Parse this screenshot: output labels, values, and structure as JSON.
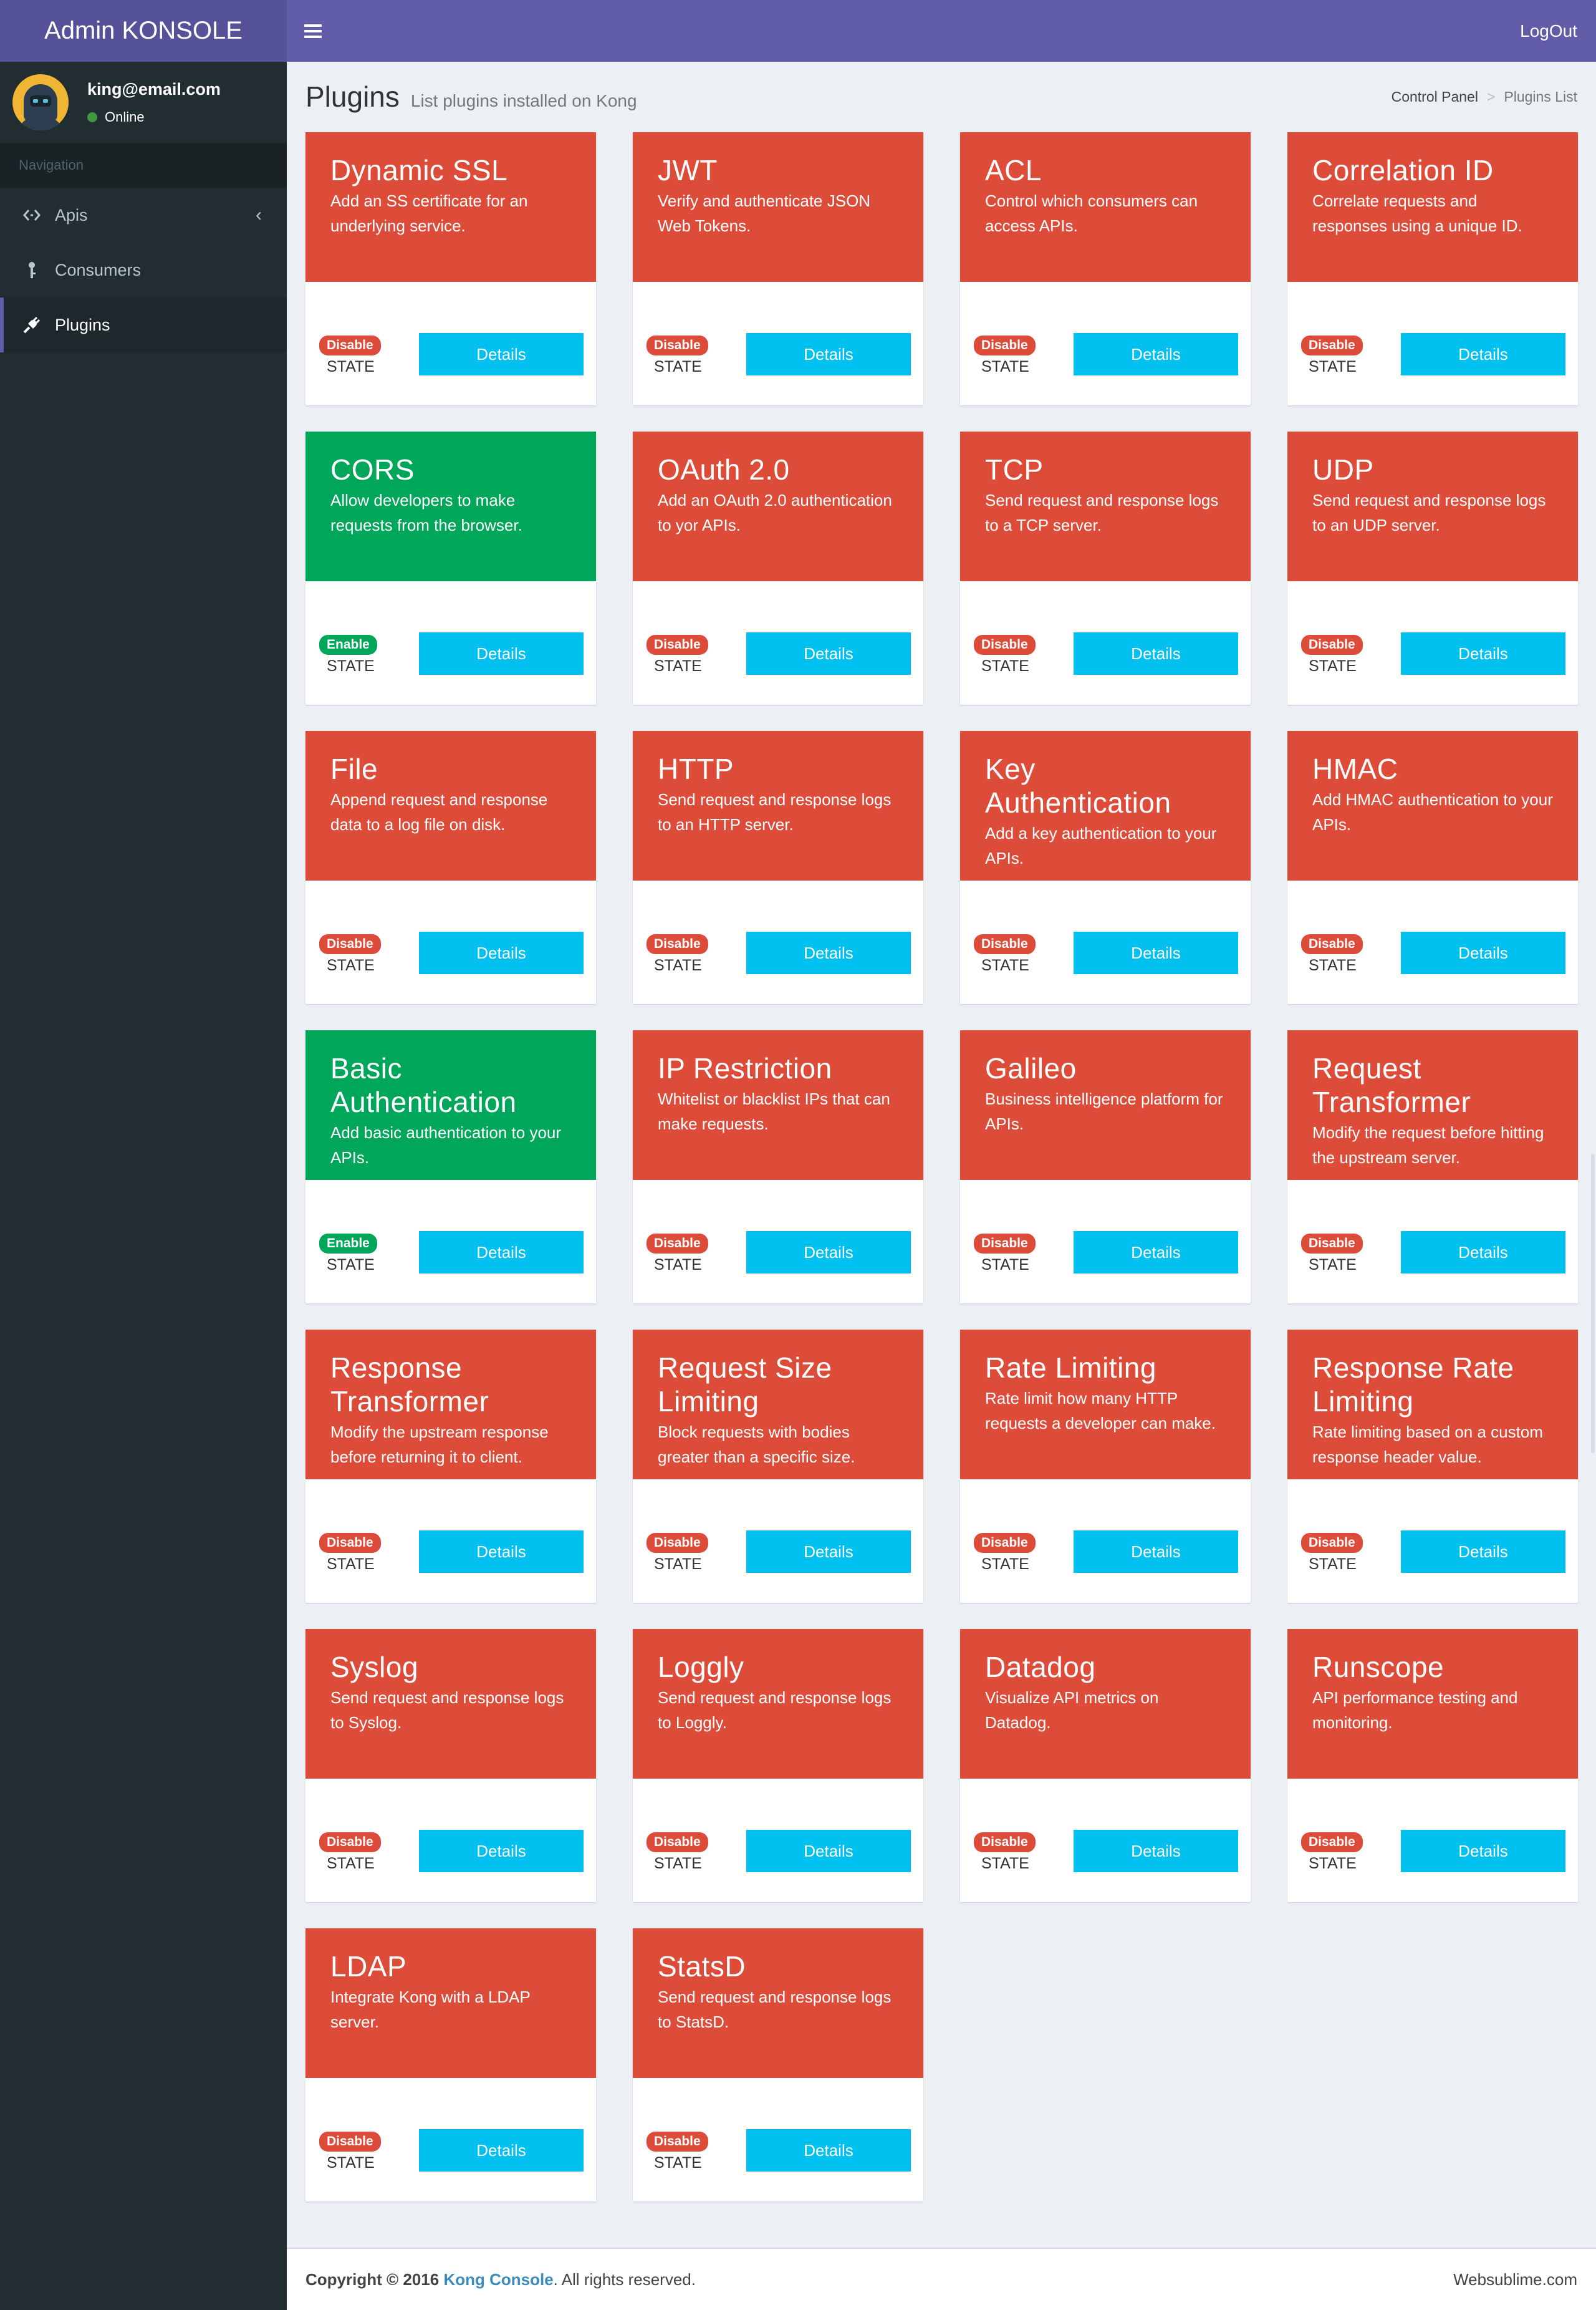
{
  "header": {
    "logo": "Admin KONSOLE",
    "logout": "LogOut"
  },
  "user": {
    "email": "king@email.com",
    "status": "Online"
  },
  "nav": {
    "header": "Navigation",
    "items": [
      {
        "label": "Apis",
        "icon": "code-icon"
      },
      {
        "label": "Consumers",
        "icon": "key-icon"
      },
      {
        "label": "Plugins",
        "icon": "plug-icon"
      }
    ]
  },
  "page": {
    "title": "Plugins",
    "subtitle": "List plugins installed on Kong"
  },
  "breadcrumb": {
    "home": "Control Panel",
    "current": "Plugins List"
  },
  "card_state_label": "STATE",
  "card_button_label": "Details",
  "plugins": [
    {
      "name": "Dynamic SSL",
      "description": "Add an SS certificate for an underlying service.",
      "state": "Disable",
      "color": "#dd4b39"
    },
    {
      "name": "JWT",
      "description": "Verify and authenticate JSON Web Tokens.",
      "state": "Disable",
      "color": "#dd4b39"
    },
    {
      "name": "ACL",
      "description": "Control which consumers can access APIs.",
      "state": "Disable",
      "color": "#dd4b39"
    },
    {
      "name": "Correlation ID",
      "description": "Correlate requests and responses using a unique ID.",
      "state": "Disable",
      "color": "#dd4b39"
    },
    {
      "name": "CORS",
      "description": "Allow developers to make requests from the browser.",
      "state": "Enable",
      "color": "#00a65a"
    },
    {
      "name": "OAuth 2.0",
      "description": "Add an OAuth 2.0 authentication to yor APIs.",
      "state": "Disable",
      "color": "#dd4b39"
    },
    {
      "name": "TCP",
      "description": "Send request and response logs to a TCP server.",
      "state": "Disable",
      "color": "#dd4b39"
    },
    {
      "name": "UDP",
      "description": "Send request and response logs to an UDP server.",
      "state": "Disable",
      "color": "#dd4b39"
    },
    {
      "name": "File",
      "description": "Append request and response data to a log file on disk.",
      "state": "Disable",
      "color": "#dd4b39"
    },
    {
      "name": "HTTP",
      "description": "Send request and response logs to an HTTP server.",
      "state": "Disable",
      "color": "#dd4b39"
    },
    {
      "name": "Key Authentication",
      "description": "Add a key authentication to your APIs.",
      "state": "Disable",
      "color": "#dd4b39"
    },
    {
      "name": "HMAC",
      "description": "Add HMAC authentication to your APIs.",
      "state": "Disable",
      "color": "#dd4b39"
    },
    {
      "name": "Basic Authentication",
      "description": "Add basic authentication to your APIs.",
      "state": "Enable",
      "color": "#00a65a"
    },
    {
      "name": "IP Restriction",
      "description": "Whitelist or blacklist IPs that can make requests.",
      "state": "Disable",
      "color": "#dd4b39"
    },
    {
      "name": "Galileo",
      "description": "Business intelligence platform for APIs.",
      "state": "Disable",
      "color": "#dd4b39"
    },
    {
      "name": "Request Transformer",
      "description": "Modify the request before hitting the upstream server.",
      "state": "Disable",
      "color": "#dd4b39"
    },
    {
      "name": "Response Transformer",
      "description": "Modify the upstream response before returning it to client.",
      "state": "Disable",
      "color": "#dd4b39"
    },
    {
      "name": "Request Size Limiting",
      "description": "Block requests with bodies greater than a specific size.",
      "state": "Disable",
      "color": "#dd4b39"
    },
    {
      "name": "Rate Limiting",
      "description": "Rate limit how many HTTP requests a developer can make.",
      "state": "Disable",
      "color": "#dd4b39"
    },
    {
      "name": "Response Rate Limiting",
      "description": "Rate limiting based on a custom response header value.",
      "state": "Disable",
      "color": "#dd4b39"
    },
    {
      "name": "Syslog",
      "description": "Send request and response logs to Syslog.",
      "state": "Disable",
      "color": "#dd4b39"
    },
    {
      "name": "Loggly",
      "description": "Send request and response logs to Loggly.",
      "state": "Disable",
      "color": "#dd4b39"
    },
    {
      "name": "Datadog",
      "description": "Visualize API metrics on Datadog.",
      "state": "Disable",
      "color": "#dd4b39"
    },
    {
      "name": "Runscope",
      "description": "API performance testing and monitoring.",
      "state": "Disable",
      "color": "#dd4b39"
    },
    {
      "name": "LDAP",
      "description": "Integrate Kong with a LDAP server.",
      "state": "Disable",
      "color": "#dd4b39"
    },
    {
      "name": "StatsD",
      "description": "Send request and response logs to StatsD.",
      "state": "Disable",
      "color": "#dd4b39"
    }
  ],
  "footer": {
    "copyright_prefix": "Copyright © 2016",
    "brand": "Kong Console",
    "suffix": ". All rights reserved.",
    "right": "Websublime.com"
  }
}
